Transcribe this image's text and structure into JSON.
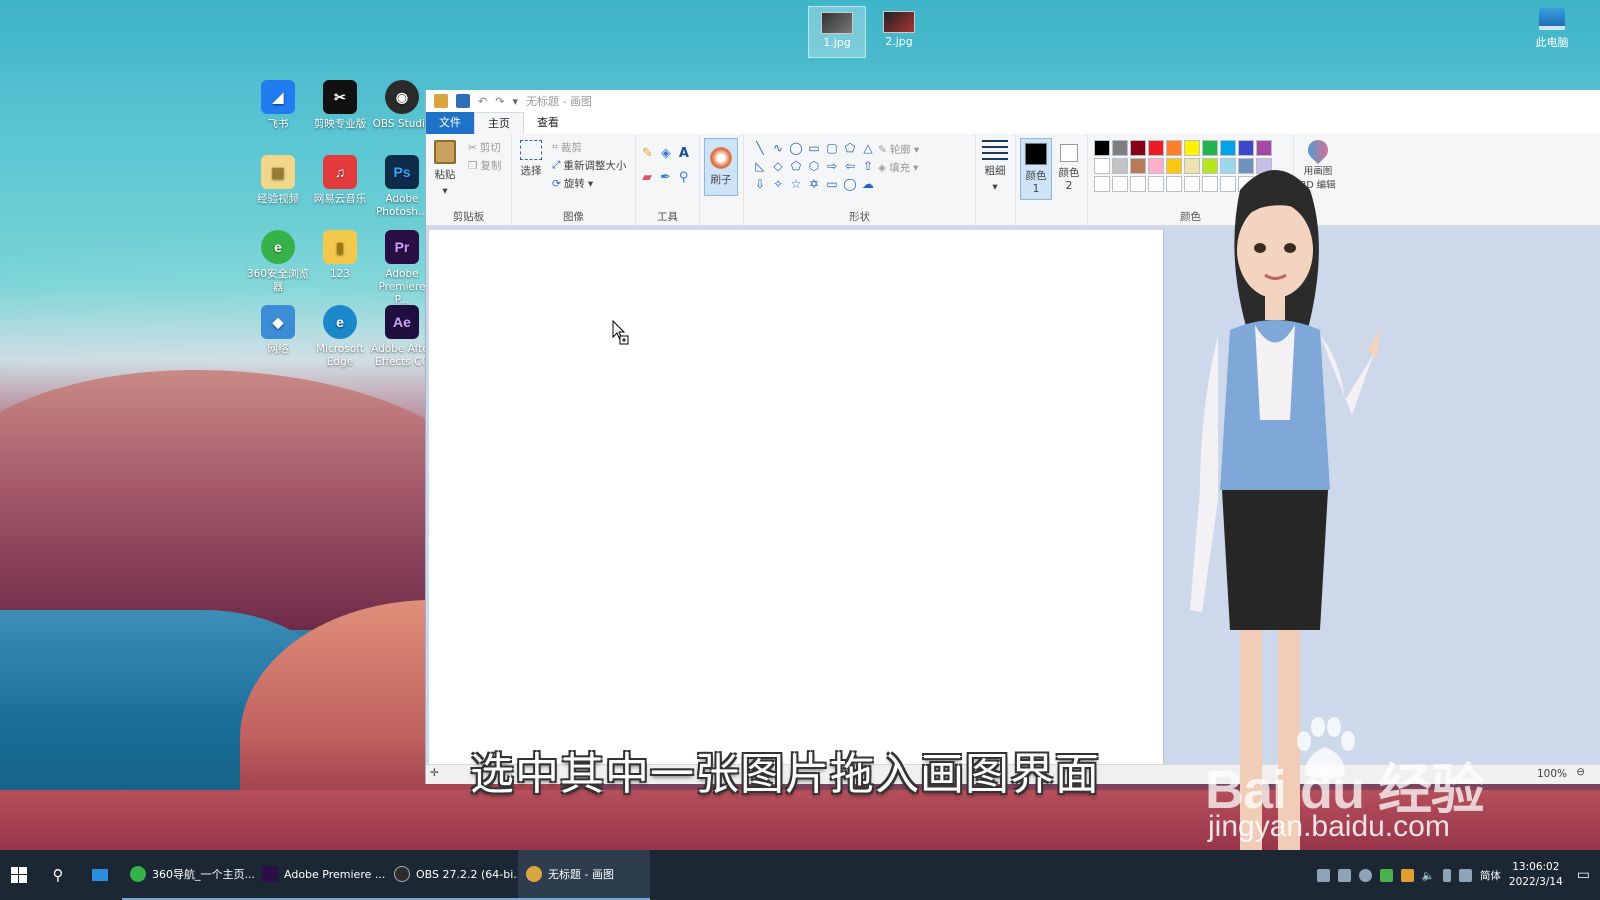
{
  "desktop": {
    "top_files": [
      "1.jpg",
      "2.jpg"
    ],
    "this_pc": "此电脑",
    "shortcuts": [
      {
        "label": "飞书",
        "color": "#1f7df0",
        "glyph": "◢"
      },
      {
        "label": "剪映专业版",
        "color": "#111111",
        "glyph": "✂"
      },
      {
        "label": "OBS Studio",
        "color": "#2b2b2b",
        "glyph": "◉"
      },
      {
        "label": "经验视频",
        "color": "#f0d78a",
        "glyph": "▤"
      },
      {
        "label": "网易云音乐",
        "color": "#e33b3b",
        "glyph": "♫"
      },
      {
        "label": "Adobe Photosh...",
        "color": "#0f2b4a",
        "glyph": "Ps"
      },
      {
        "label": "360安全浏览器",
        "color": "#35b24a",
        "glyph": "e"
      },
      {
        "label": "123",
        "color": "#f2c94c",
        "glyph": "▮"
      },
      {
        "label": "Adobe Premiere P...",
        "color": "#2a0f45",
        "glyph": "Pr"
      },
      {
        "label": "网络",
        "color": "#3a8dd6",
        "glyph": "◆"
      },
      {
        "label": "Microsoft Edge",
        "color": "#1a88c9",
        "glyph": "e"
      },
      {
        "label": "Adobe After Effects CC",
        "color": "#1f0f3f",
        "glyph": "Ae"
      }
    ]
  },
  "paint": {
    "title": "无标题 - 画图",
    "tabs": [
      "文件",
      "主页",
      "查看"
    ],
    "clipboard": {
      "paste": "粘贴",
      "cut": "剪切",
      "copy": "复制",
      "label": "剪贴板"
    },
    "image": {
      "select": "选择",
      "crop": "裁剪",
      "resize": "重新调整大小",
      "rotate": "旋转",
      "label": "图像"
    },
    "tools": {
      "label": "工具"
    },
    "brush": {
      "label": "刷子"
    },
    "shapes": {
      "label": "形状",
      "outline": "轮廓",
      "fill": "填充"
    },
    "size": {
      "label": "粗细"
    },
    "color1": "颜色 1",
    "color2": "颜色 2",
    "colors": {
      "label": "颜色",
      "row1": [
        "#000000",
        "#7f7f7f",
        "#880015",
        "#ed1c24",
        "#ff7f27",
        "#fff200",
        "#22b14c",
        "#00a2e8",
        "#3f48cc",
        "#a349a4"
      ],
      "row2": [
        "#ffffff",
        "#c3c3c3",
        "#b97a57",
        "#ffaec9",
        "#ffc90e",
        "#efe4b0",
        "#b5e61d",
        "#99d9ea",
        "#7092be",
        "#c8bfe7"
      ],
      "row3": [
        "#ffffff",
        "#ffffff",
        "#ffffff",
        "#ffffff",
        "#ffffff",
        "#ffffff",
        "#ffffff",
        "#ffffff",
        "#ffffff",
        "#ffffff"
      ]
    },
    "paint3d": "用画图 3D 编辑",
    "zoom": "100%"
  },
  "subtitle": "选中其中一张图片拖入画图界面",
  "watermark": {
    "logo": "Bai  du 经验",
    "url": "jingyan.baidu.com"
  },
  "taskbar": {
    "apps": [
      {
        "label": "360导航_一个主页...",
        "color": "#35b24a",
        "active": false
      },
      {
        "label": "Adobe Premiere ...",
        "color": "#2a0f45",
        "active": false
      },
      {
        "label": "OBS 27.2.2 (64-bi...",
        "color": "#2b2b2b",
        "active": false
      },
      {
        "label": "无标题 - 画图",
        "color": "#d9a441",
        "active": true
      }
    ],
    "ime": "简体",
    "time": "13:06:02",
    "date": "2022/3/14"
  }
}
